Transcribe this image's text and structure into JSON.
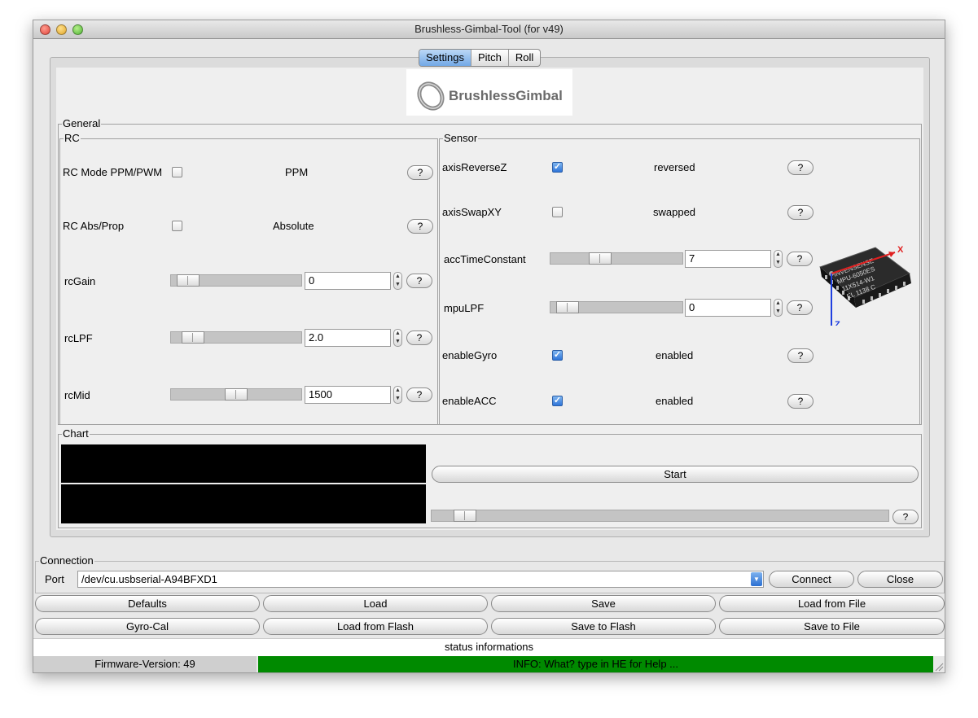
{
  "window": {
    "title": "Brushless-Gimbal-Tool (for v49)"
  },
  "tabs": [
    {
      "label": "Settings",
      "active": true
    },
    {
      "label": "Pitch",
      "active": false
    },
    {
      "label": "Roll",
      "active": false
    }
  ],
  "logo": {
    "text": "BrushlessGimbal"
  },
  "general": {
    "label": "General",
    "rc": {
      "label": "RC",
      "mode_label": "RC Mode PPM/PWM",
      "mode_checked": false,
      "mode_status": "PPM",
      "absprop_label": "RC Abs/Prop",
      "absprop_checked": false,
      "absprop_status": "Absolute",
      "gain_label": "rcGain",
      "gain_value": "0",
      "gain_level": 0.05,
      "lpf_label": "rcLPF",
      "lpf_value": "2.0",
      "lpf_level": 0.1,
      "mid_label": "rcMid",
      "mid_value": "1500",
      "mid_level": 0.5
    },
    "sensor": {
      "label": "Sensor",
      "reversez_label": "axisReverseZ",
      "reversez_checked": true,
      "reversez_status": "reversed",
      "swapxy_label": "axisSwapXY",
      "swapxy_checked": false,
      "swapxy_status": "swapped",
      "acctime_label": "accTimeConstant",
      "acctime_value": "7",
      "acctime_level": 0.35,
      "mpulpf_label": "mpuLPF",
      "mpulpf_value": "0",
      "mpulpf_level": 0.05,
      "gyro_label": "enableGyro",
      "gyro_checked": true,
      "gyro_status": "enabled",
      "acc_label": "enableACC",
      "acc_checked": true,
      "acc_status": "enabled",
      "chip": {
        "line1": "INVENSENSE",
        "line2": "MPU-6050ES",
        "line3": "11X514-W1",
        "line4": "EL 1138 C",
        "x_axis": "X",
        "z_axis": "Z"
      }
    },
    "help_label": "?",
    "spin_up": "▲",
    "spin_down": "▼"
  },
  "chart": {
    "label": "Chart",
    "start_label": "Start",
    "slider_level": 0.05
  },
  "connection": {
    "label": "Connection",
    "port_label": "Port",
    "port_value": "/dev/cu.usbserial-A94BFXD1",
    "connect_label": "Connect",
    "close_label": "Close"
  },
  "actions": {
    "defaults": "Defaults",
    "load": "Load",
    "save": "Save",
    "load_file": "Load from File",
    "gyro_cal": "Gyro-Cal",
    "load_flash": "Load from Flash",
    "save_flash": "Save to Flash",
    "save_file": "Save to File"
  },
  "status": {
    "header": "status informations",
    "firmware": "Firmware-Version: 49",
    "info": "INFO: What? type in HE for Help ...",
    "info_color": "#008a00"
  }
}
